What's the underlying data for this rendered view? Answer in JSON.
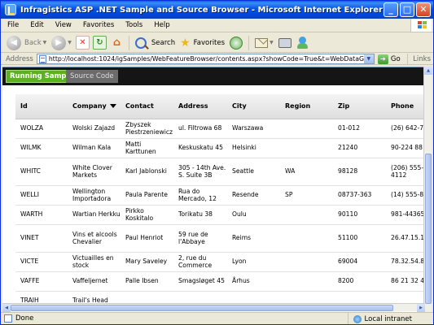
{
  "window": {
    "title": "Infragistics ASP .NET Sample and Source Browser - Microsoft Internet Explorer",
    "min": "_",
    "max": "□",
    "close": "✕"
  },
  "menu": [
    "File",
    "Edit",
    "View",
    "Favorites",
    "Tools",
    "Help"
  ],
  "toolbar": {
    "back": "Back",
    "search": "Search",
    "favorites": "Favorites"
  },
  "address": {
    "label": "Address",
    "url": "http://localhost:1024/igSamples/WebFeatureBrowser/contents.aspx?showCode=True&t=WebDataGrid/Sorting/WebData",
    "go": "Go",
    "links": "Links"
  },
  "tabs": {
    "running": "Running Sample",
    "source": "Source Code"
  },
  "grid": {
    "columns": [
      "Id",
      "Company",
      "Contact",
      "Address",
      "City",
      "Region",
      "Zip",
      "Phone"
    ],
    "rows": [
      [
        "WOLZA",
        "Wolski Zajazd",
        "Zbyszek Piestrzeniewicz",
        "ul. Filtrowa 68",
        "Warszawa",
        "",
        "01-012",
        "(26) 642-7"
      ],
      [
        "WILMK",
        "Wilman Kala",
        "Matti Karttunen",
        "Keskuskatu 45",
        "Helsinki",
        "",
        "21240",
        "90-224 88"
      ],
      [
        "WHITC",
        "White Clover Markets",
        "Karl Jablonski",
        "305 - 14th Ave. S. Suite 3B",
        "Seattle",
        "WA",
        "98128",
        "(206) 555-4112"
      ],
      [
        "WELLI",
        "Wellington Importadora",
        "Paula Parente",
        "Rua do Mercado, 12",
        "Resende",
        "SP",
        "08737-363",
        "(14) 555-8"
      ],
      [
        "WARTH",
        "Wartian Herkku",
        "Pirkko Koskitalo",
        "Torikatu 38",
        "Oulu",
        "",
        "90110",
        "981-44365"
      ],
      [
        "VINET",
        "Vins et alcools Chevalier",
        "Paul Henriot",
        "59 rue de l'Abbaye",
        "Reims",
        "",
        "51100",
        "26.47.15.1"
      ],
      [
        "VICTE",
        "Victuailles en stock",
        "Mary Saveley",
        "2, rue du Commerce",
        "Lyon",
        "",
        "69004",
        "78.32.54.8"
      ],
      [
        "VAFFE",
        "Vaffeljernet",
        "Palle Ibsen",
        "Smagsløget 45",
        "Århus",
        "",
        "8200",
        "86 21 32 4"
      ],
      [
        "TRAIH",
        "Trail's Head",
        "",
        "",
        "",
        "",
        "",
        ""
      ]
    ]
  },
  "status": {
    "done": "Done",
    "zone": "Local intranet"
  },
  "colors": {
    "title_bar": "#0553e0",
    "active_tab": "#5cb022",
    "tab_strip": "#151515"
  }
}
